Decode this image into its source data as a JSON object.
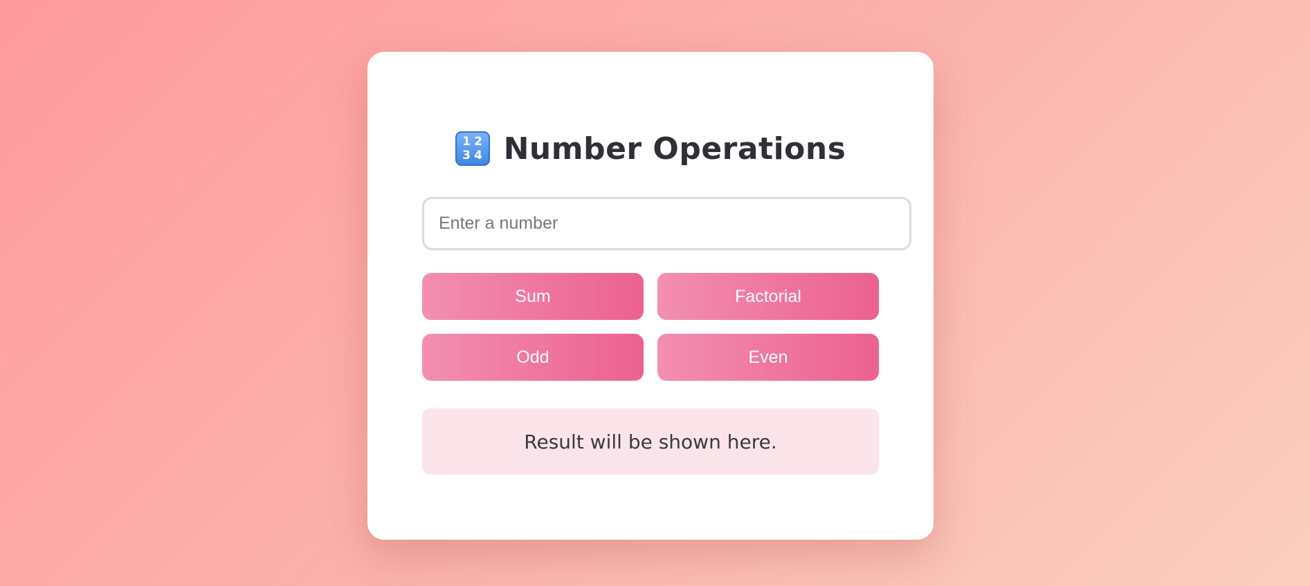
{
  "title": {
    "icon": "input-numbers-icon",
    "icon_digits": [
      "1",
      "2",
      "3",
      "4"
    ],
    "text": "Number Operations"
  },
  "input": {
    "placeholder": "Enter a number",
    "value": ""
  },
  "buttons": {
    "sum": "Sum",
    "factorial": "Factorial",
    "odd": "Odd",
    "even": "Even"
  },
  "result": {
    "text": "Result will be shown here."
  },
  "colors": {
    "background_gradient": [
      "#ff9a9e",
      "#fbcfc0"
    ],
    "button_gradient": [
      "#f38fb0",
      "#ec6190"
    ],
    "result_background": "#fae4ea",
    "title_color": "#2f2f36"
  }
}
